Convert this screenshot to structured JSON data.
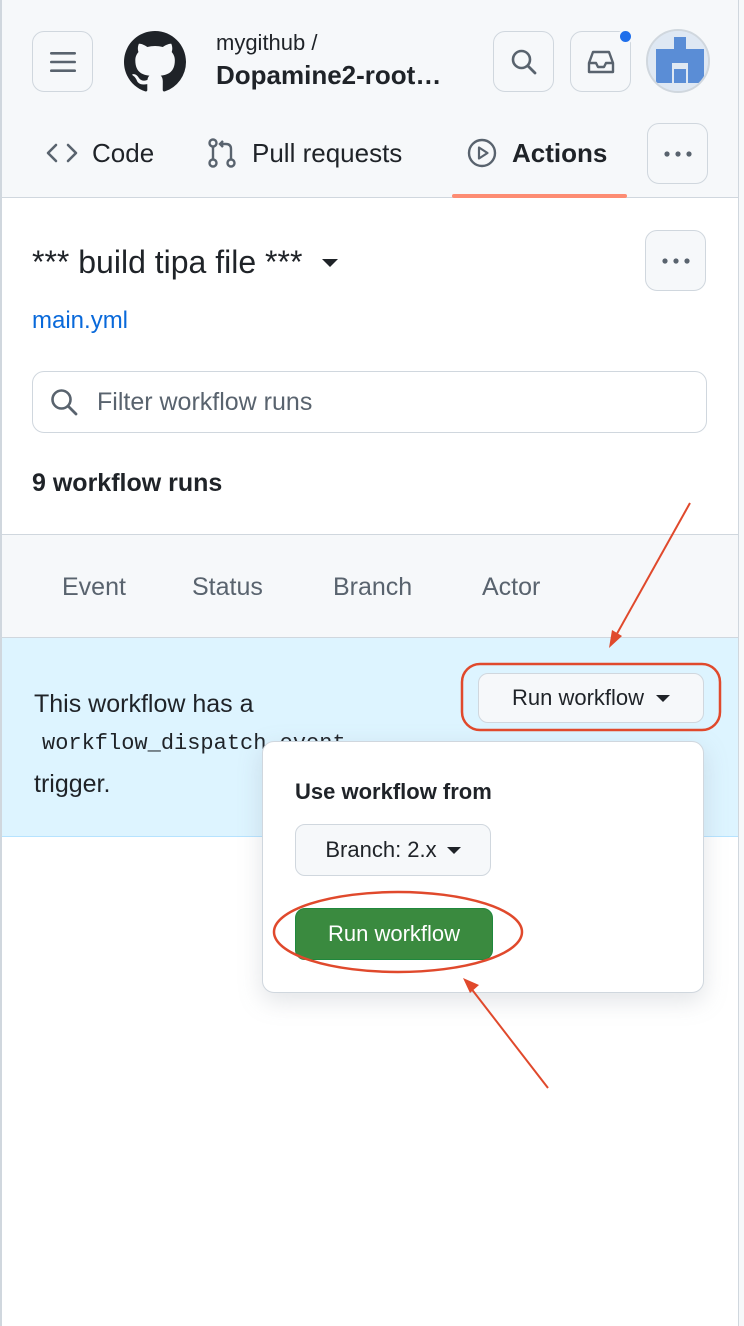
{
  "header": {
    "owner": "mygithub /",
    "repo": "Dopamine2-root…",
    "icons": {
      "menu": "hamburger-menu-icon",
      "logo": "github-octocat-logo",
      "search": "search-icon",
      "inbox": "inbox-icon",
      "avatar": "user-avatar"
    },
    "notification_dot_color": "#1f6feb"
  },
  "tabs": [
    {
      "label": "Code",
      "icon": "code-icon"
    },
    {
      "label": "Pull requests",
      "icon": "git-pull-request-icon"
    },
    {
      "label": "Actions",
      "icon": "play-circle-icon",
      "selected": true
    }
  ],
  "workflow": {
    "title": "*** build tipa file ***",
    "file": "main.yml",
    "filter_placeholder": "Filter workflow runs",
    "run_count": "9 workflow runs"
  },
  "filters": [
    "Event",
    "Status",
    "Branch",
    "Actor"
  ],
  "dispatch": {
    "text_before": "This workflow has a",
    "code": "workflow_dispatch event",
    "text_after": "trigger.",
    "button_label": "Run workflow"
  },
  "popover": {
    "title": "Use workflow from",
    "branch_label": "Branch: 2.x",
    "run_button_label": "Run workflow"
  },
  "colors": {
    "accent_underline": "#fd8c73",
    "link": "#0969da",
    "banner_bg": "#ddf4ff",
    "primary_button": "#3a8a3f",
    "annotation": "#e0492c"
  }
}
